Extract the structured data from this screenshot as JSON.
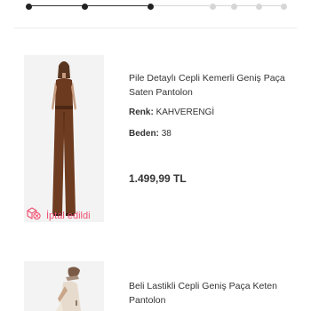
{
  "stepper": {
    "steps_total": 7,
    "steps_completed": 3,
    "active_color": "#222222",
    "inactive_color": "#d6d6d6"
  },
  "orders": [
    {
      "name": "Pile Detaylı Cepli Kemerli Geniş Paça Saten Pantolon",
      "color_label": "Renk:",
      "color_value": "KAHVERENGİ",
      "size_label": "Beden:",
      "size_value": "38",
      "price": "1.499,99 TL",
      "status": "İptal edildi",
      "status_icon": "cancelled-package-icon",
      "status_color": "#ef4f70"
    },
    {
      "name": "Beli Lastikli Cepli Geniş Paça Keten Pantolon"
    }
  ]
}
